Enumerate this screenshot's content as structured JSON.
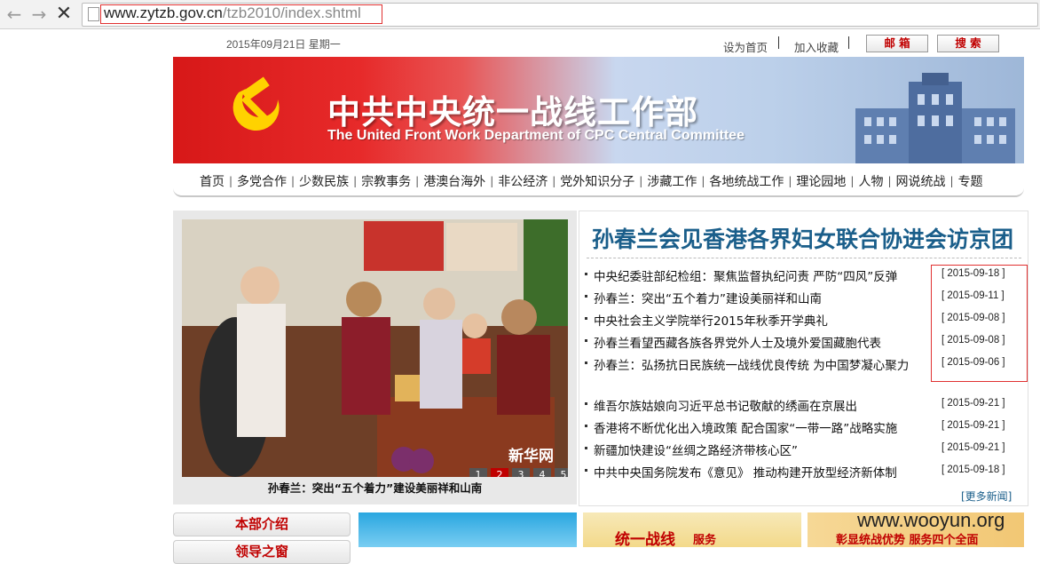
{
  "browser": {
    "url_domain": "www.zytzb.gov.cn",
    "url_path": "/tzb2010/index.shtml"
  },
  "topbar": {
    "date": "2015年09月21日 星期一",
    "set_home": "设为首页",
    "bookmark": "加入收藏",
    "mail": "邮 箱",
    "search": "搜 索"
  },
  "banner": {
    "title_cn": "中共中央统一战线工作部",
    "title_en": "The United Front Work Department of CPC Central Committee"
  },
  "menu": [
    "首页",
    "多党合作",
    "少数民族",
    "宗教事务",
    "港澳台海外",
    "非公经济",
    "党外知识分子",
    "涉藏工作",
    "各地统战工作",
    "理论园地",
    "人物",
    "网说统战",
    "专题"
  ],
  "photo": {
    "caption": "孙春兰：突出“五个着力”建设美丽祥和山南",
    "watermark": "新华网",
    "pages": [
      "1",
      "2",
      "3",
      "4",
      "5"
    ],
    "active_page": "2"
  },
  "news": {
    "headline": "孙春兰会见香港各界妇女联合协进会访京团",
    "group1": [
      {
        "title": "中央纪委驻部纪检组：聚焦监督执纪问责 严防“四风”反弹",
        "date": "[ 2015-09-18 ]"
      },
      {
        "title": "孙春兰：突出“五个着力”建设美丽祥和山南",
        "date": "[ 2015-09-11 ]"
      },
      {
        "title": "中央社会主义学院举行2015年秋季开学典礼",
        "date": "[ 2015-09-08 ]"
      },
      {
        "title": "孙春兰看望西藏各族各界党外人士及境外爱国藏胞代表",
        "date": "[ 2015-09-08 ]"
      },
      {
        "title": "孙春兰：弘扬抗日民族统一战线优良传统 为中国梦凝心聚力",
        "date": "[ 2015-09-06 ]"
      }
    ],
    "group2": [
      {
        "title": "维吾尔族姑娘向习近平总书记敬献的绣画在京展出",
        "date": "[ 2015-09-21 ]"
      },
      {
        "title": "香港将不断优化出入境政策 配合国家“一带一路”战略实施",
        "date": "[ 2015-09-21 ]"
      },
      {
        "title": "新疆加快建设“丝绸之路经济带核心区”",
        "date": "[ 2015-09-21 ]"
      },
      {
        "title": "中共中央国务院发布《意见》 推动构建开放型经济新体制",
        "date": "[ 2015-09-18 ]"
      }
    ],
    "more": "[更多新闻]"
  },
  "bottom": {
    "intro": "本部介绍",
    "leaders": "领导之窗",
    "promo2_title": "统一战线",
    "promo2_sub": "服务",
    "promo3_text": "彰显统战优势  服务四个全面"
  },
  "site_watermark": "www.wooyun.org"
}
